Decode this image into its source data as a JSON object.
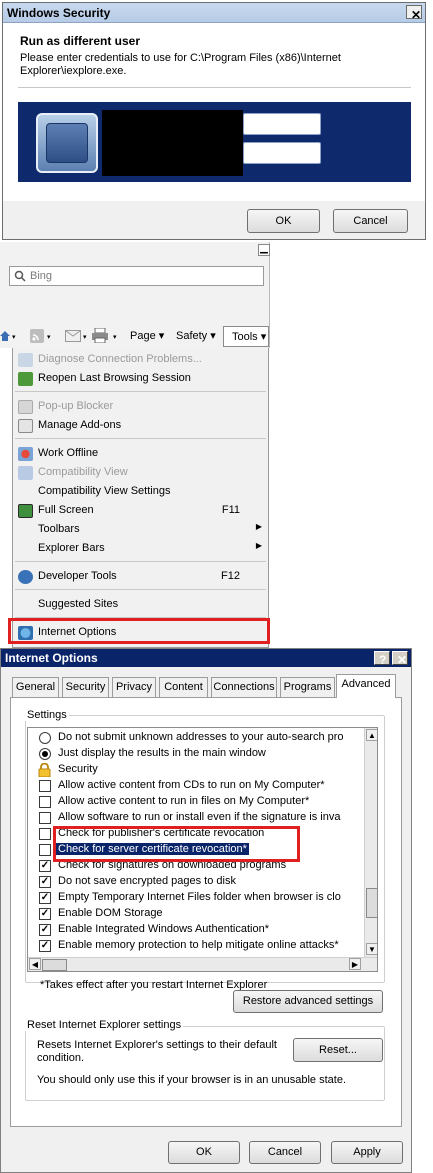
{
  "security_dialog": {
    "title": "Windows Security",
    "heading": "Run as different user",
    "message_line1": "Please enter credentials to use for C:\\Program Files (x86)\\Internet",
    "message_line2": "Explorer\\iexplore.exe.",
    "ok_label": "OK",
    "cancel_label": "Cancel",
    "close_glyph": "✕"
  },
  "browser": {
    "minimize_glyph": "▁",
    "search_placeholder": "Bing",
    "toolbar": {
      "page_label": "Page ▾",
      "safety_label": "Safety ▾",
      "tools_label": "Tools ▾"
    }
  },
  "tools_menu": {
    "items": [
      {
        "label": "Diagnose Connection Problems...",
        "disabled": true,
        "icon": "diagnose-icon"
      },
      {
        "label": "Reopen Last Browsing Session",
        "disabled": false,
        "icon": "reopen-session-icon"
      },
      {
        "label": "Pop-up Blocker",
        "disabled": true,
        "icon": "popup-blocker-icon"
      },
      {
        "label": "Manage Add-ons",
        "disabled": false,
        "icon": "manage-addons-icon"
      },
      {
        "label": "Work Offline",
        "disabled": false,
        "icon": "work-offline-icon"
      },
      {
        "label": "Compatibility View",
        "disabled": true,
        "icon": "compatibility-view-icon"
      },
      {
        "label": "Compatibility View Settings",
        "disabled": false
      },
      {
        "label": "Full Screen",
        "shortcut": "F11",
        "disabled": false,
        "icon": "full-screen-icon"
      },
      {
        "label": "Toolbars",
        "submenu": true,
        "disabled": false
      },
      {
        "label": "Explorer Bars",
        "submenu": true,
        "disabled": false
      },
      {
        "label": "Developer Tools",
        "shortcut": "F12",
        "disabled": false,
        "icon": "developer-tools-icon"
      },
      {
        "label": "Suggested Sites",
        "disabled": false
      },
      {
        "label": "Internet Options",
        "disabled": false,
        "icon": "internet-options-icon"
      }
    ]
  },
  "internet_options": {
    "title": "Internet Options",
    "help_glyph": "?",
    "close_glyph": "✕",
    "tabs": [
      "General",
      "Security",
      "Privacy",
      "Content",
      "Connections",
      "Programs",
      "Advanced"
    ],
    "active_tab": "Advanced",
    "settings_label": "Settings",
    "settings_rows": [
      {
        "label": "Do not submit unknown addresses to your auto-search pro",
        "type": "radio",
        "checked": false
      },
      {
        "label": "Just display the results in the main window",
        "type": "radio",
        "checked": true
      },
      {
        "label": "Security",
        "type": "group"
      },
      {
        "label": "Allow active content from CDs to run on My Computer*",
        "type": "checkbox",
        "checked": false
      },
      {
        "label": "Allow active content to run in files on My Computer*",
        "type": "checkbox",
        "checked": false
      },
      {
        "label": "Allow software to run or install even if the signature is inva",
        "type": "checkbox",
        "checked": false
      },
      {
        "label": "Check for publisher's certificate revocation",
        "type": "checkbox",
        "checked": false
      },
      {
        "label": "Check for server certificate revocation*",
        "type": "checkbox",
        "checked": false,
        "selected": true
      },
      {
        "label": "Check for signatures on downloaded programs",
        "type": "checkbox",
        "checked": true
      },
      {
        "label": "Do not save encrypted pages to disk",
        "type": "checkbox",
        "checked": true
      },
      {
        "label": "Empty Temporary Internet Files folder when browser is clo",
        "type": "checkbox",
        "checked": true
      },
      {
        "label": "Enable DOM Storage",
        "type": "checkbox",
        "checked": true
      },
      {
        "label": "Enable Integrated Windows Authentication*",
        "type": "checkbox",
        "checked": true
      },
      {
        "label": "Enable memory protection to help mitigate online attacks*",
        "type": "checkbox",
        "checked": true
      }
    ],
    "restart_note": "*Takes effect after you restart Internet Explorer",
    "restore_label": "Restore advanced settings",
    "reset_group_label": "Reset Internet Explorer settings",
    "reset_desc_line1": "Resets Internet Explorer's settings to their default",
    "reset_desc_line2": "condition.",
    "reset_button_label": "Reset...",
    "reset_warning": "You should only use this if your browser is in an unusable state.",
    "ok_label": "OK",
    "cancel_label": "Cancel",
    "apply_label": "Apply"
  },
  "colors": {
    "highlight_border": "#e02020",
    "selection_bg": "#0a246a",
    "security_band": "#0f2a6c"
  }
}
